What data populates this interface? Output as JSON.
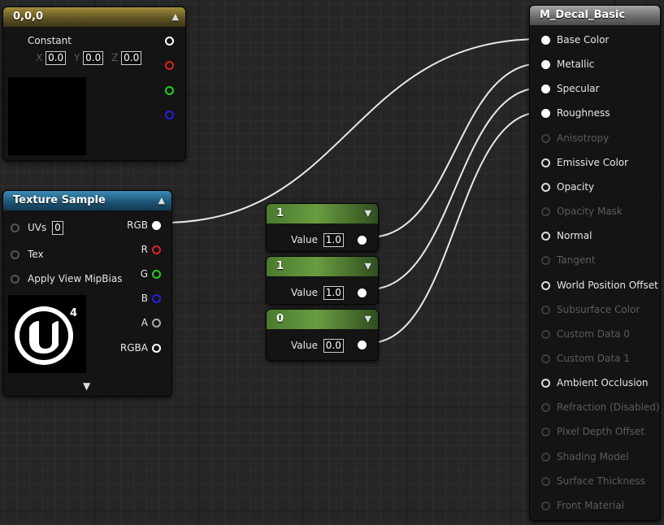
{
  "constant_node": {
    "title": "0,0,0",
    "label": "Constant",
    "x_label": "X",
    "x_value": "0.0",
    "y_label": "Y",
    "y_value": "0.0",
    "z_label": "Z",
    "z_value": "0.0",
    "header_color": "#8a7a35",
    "pin_colors": [
      "#ffffff",
      "#e02020",
      "#20d020",
      "#2020e0"
    ]
  },
  "texture_node": {
    "title": "Texture Sample",
    "header_color": "#2b6a8c",
    "inputs": [
      {
        "label": "UVs",
        "value": "0"
      },
      {
        "label": "Tex"
      },
      {
        "label": "Apply View MipBias"
      }
    ],
    "outputs": [
      "RGB",
      "R",
      "G",
      "B",
      "A",
      "RGBA"
    ],
    "thumbnail_icon": "unreal-engine-4-logo-icon"
  },
  "scalar_nodes": [
    {
      "title": "1",
      "label": "Value",
      "value": "1.0"
    },
    {
      "title": "1",
      "label": "Value",
      "value": "1.0"
    },
    {
      "title": "0",
      "label": "Value",
      "value": "0.0"
    }
  ],
  "material_node": {
    "title": "M_Decal_Basic",
    "header_color": "#8a8a8a",
    "pins": [
      {
        "label": "Base Color",
        "enabled": true
      },
      {
        "label": "Metallic",
        "enabled": true
      },
      {
        "label": "Specular",
        "enabled": true
      },
      {
        "label": "Roughness",
        "enabled": true
      },
      {
        "label": "Anisotropy",
        "enabled": false
      },
      {
        "label": "Emissive Color",
        "enabled": true
      },
      {
        "label": "Opacity",
        "enabled": true
      },
      {
        "label": "Opacity Mask",
        "enabled": false
      },
      {
        "label": "Normal",
        "enabled": true
      },
      {
        "label": "Tangent",
        "enabled": false
      },
      {
        "label": "World Position Offset",
        "enabled": true
      },
      {
        "label": "Subsurface Color",
        "enabled": false
      },
      {
        "label": "Custom Data 0",
        "enabled": false
      },
      {
        "label": "Custom Data 1",
        "enabled": false
      },
      {
        "label": "Ambient Occlusion",
        "enabled": true
      },
      {
        "label": "Refraction (Disabled)",
        "enabled": false
      },
      {
        "label": "Pixel Depth Offset",
        "enabled": false
      },
      {
        "label": "Shading Model",
        "enabled": false
      },
      {
        "label": "Surface Thickness",
        "enabled": false
      },
      {
        "label": "Front Material",
        "enabled": false
      }
    ]
  }
}
